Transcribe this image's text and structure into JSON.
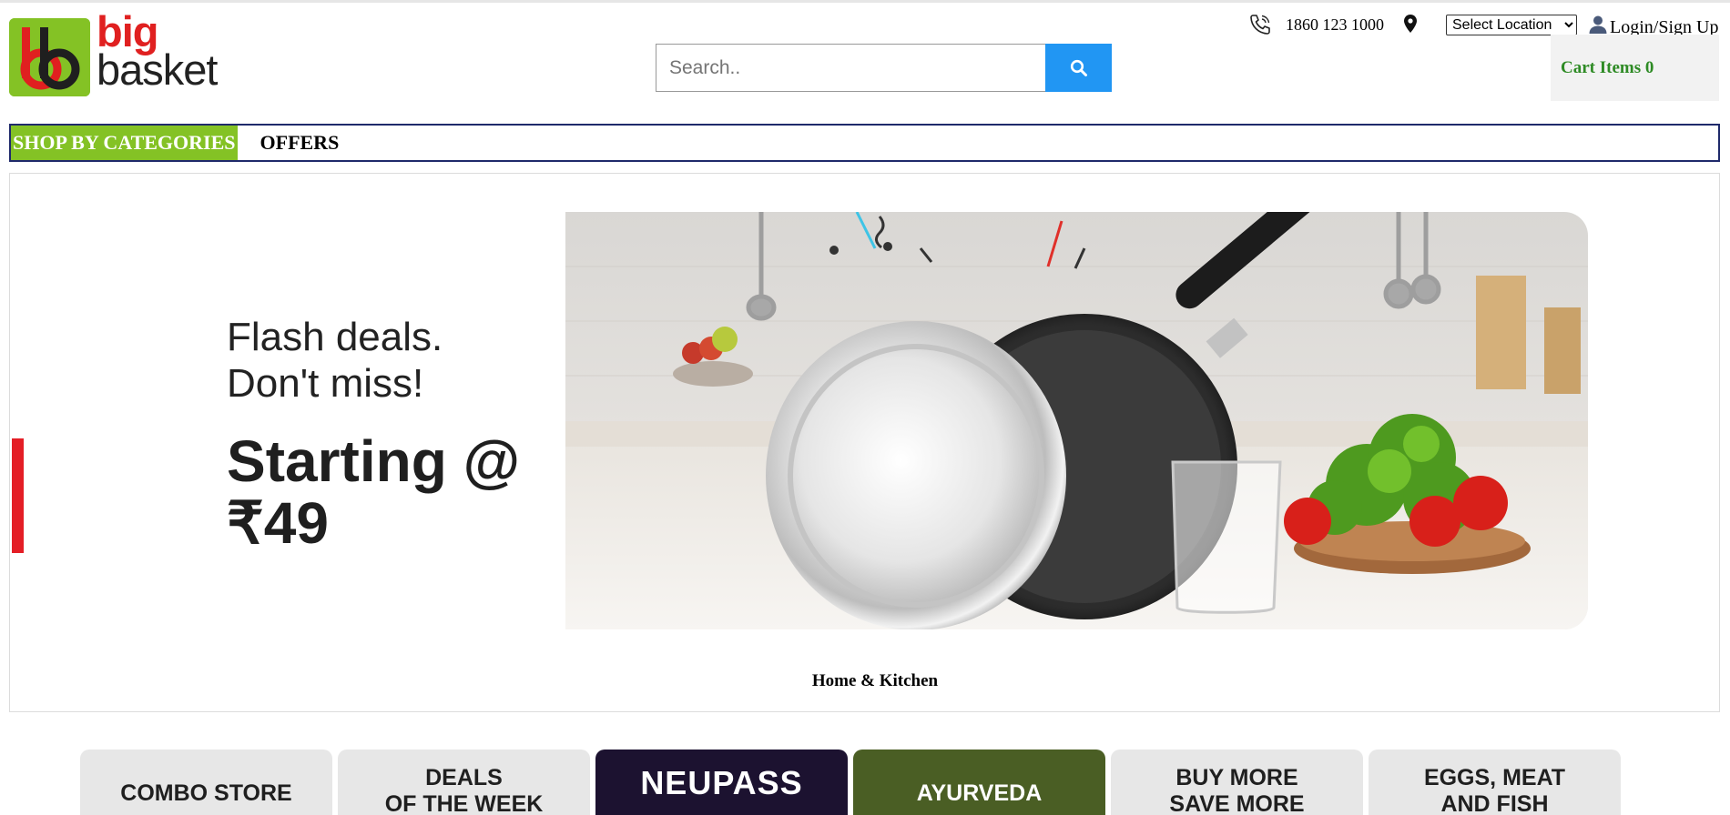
{
  "header": {
    "logo": {
      "line1": "big",
      "line2": "basket"
    },
    "search": {
      "placeholder": "Search..",
      "value": ""
    },
    "phone": "1860 123 1000",
    "location_select": {
      "selected": "Select Location"
    },
    "login_label": "Login/Sign Up",
    "cart_label": "Cart Items 0"
  },
  "nav": {
    "items": [
      {
        "label": "SHOP BY CATEGORIES"
      },
      {
        "label": "OFFERS"
      }
    ]
  },
  "banner": {
    "headline_line1": "Flash deals.",
    "headline_line2": "Don't miss!",
    "price_line1": "Starting @",
    "price_line2": "₹49",
    "caption": "Home & Kitchen"
  },
  "tiles": [
    {
      "line1": "COMBO STORE",
      "line2": ""
    },
    {
      "line1": "DEALS",
      "line2": "OF THE WEEK"
    },
    {
      "line1": "NEUPASS",
      "line2": ""
    },
    {
      "line1": "AYURVEDA",
      "line2": ""
    },
    {
      "line1": "BUY MORE",
      "line2": "SAVE MORE"
    },
    {
      "line1": "EGGS, MEAT",
      "line2": "AND FISH"
    }
  ],
  "colors": {
    "brand_green": "#84c225",
    "brand_red": "#e02020",
    "search_button": "#2196f3",
    "cart_text": "#2e8b25",
    "nav_border": "#1f2a6b"
  },
  "icons": {
    "search": "search-icon",
    "phone": "phone-icon",
    "location": "location-pin-icon",
    "user": "user-icon"
  }
}
